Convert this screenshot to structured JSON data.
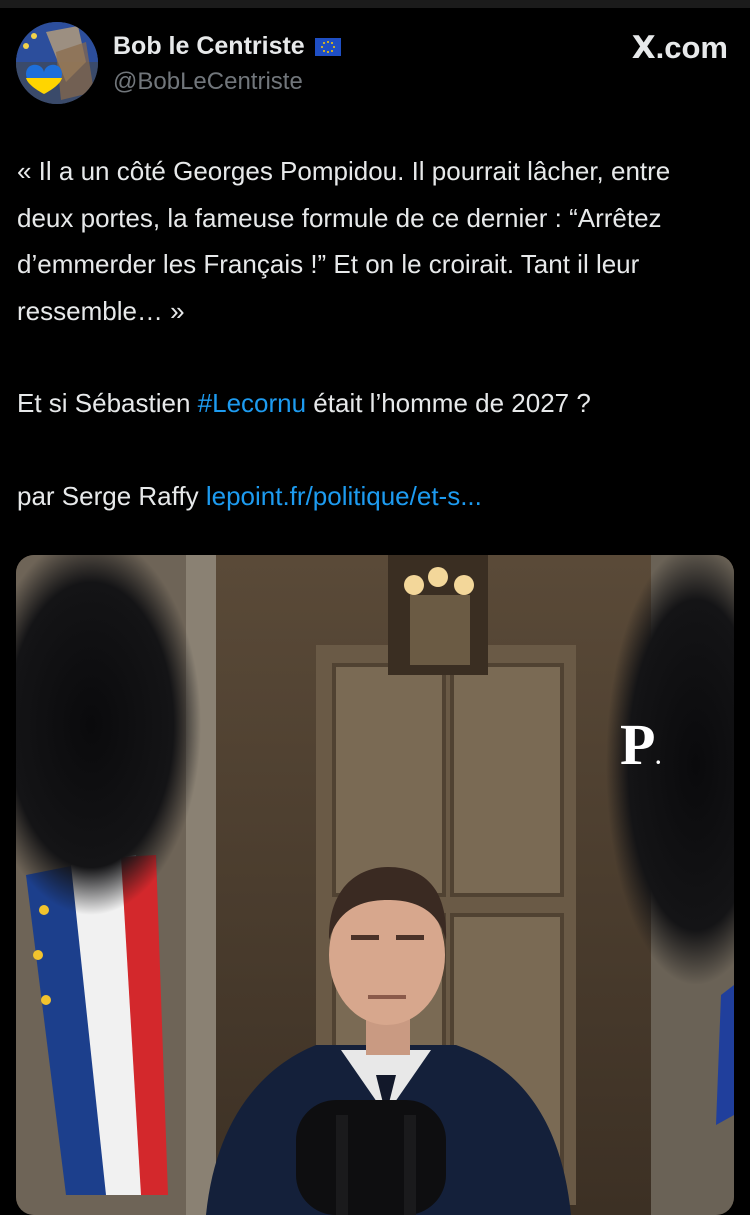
{
  "author": {
    "display_name": "Bob le Centriste",
    "handle": "@BobLeCentriste",
    "badge": "eu-flag-icon"
  },
  "site": {
    "label_x": "X",
    "label_domain": ".com"
  },
  "tweet": {
    "quote": "« Il a un côté Georges Pompidou. Il pourrait lâcher, entre deux portes, la fameuse formule de ce dernier : “Arrêtez d’emmerder les Français !” Et on le croirait. Tant il leur ressemble… »",
    "question_prefix": "Et si Sébastien ",
    "hashtag": "#Lecornu",
    "question_suffix": " était l’homme de 2027 ?",
    "byline_prefix": "par Serge Raffy ",
    "link_text": "lepoint.fr/politique/et-s..."
  },
  "media": {
    "logo_letter": "P",
    "logo_dot": "."
  },
  "colors": {
    "background": "#000000",
    "text": "#e7e9ea",
    "muted": "#71767b",
    "link": "#1d9bf0"
  }
}
